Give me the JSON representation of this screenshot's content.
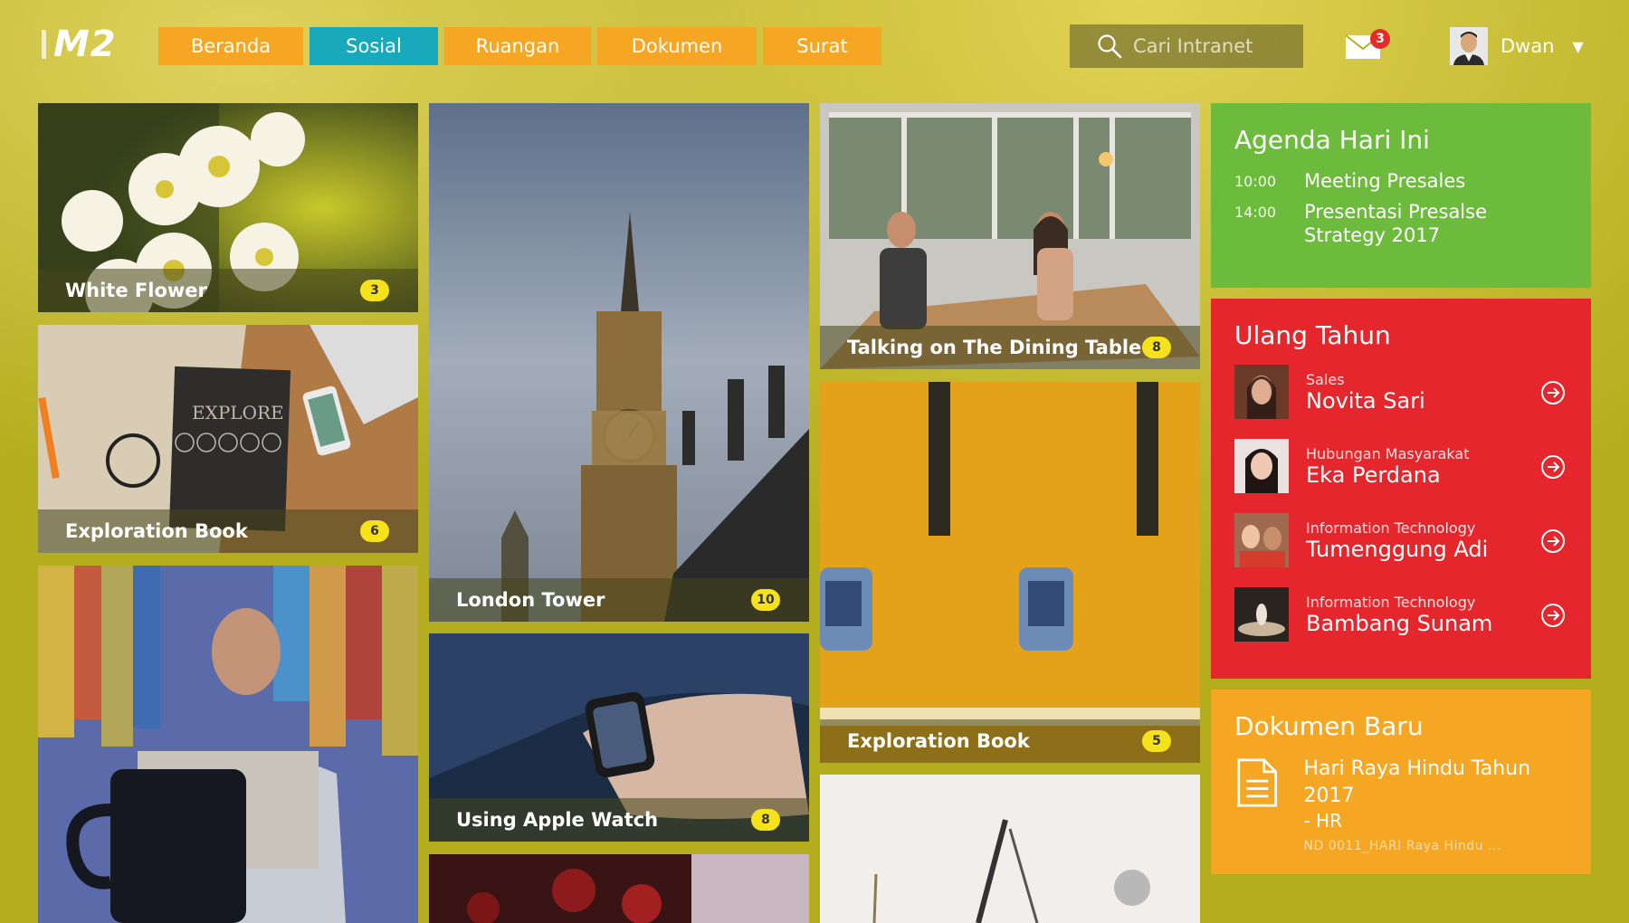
{
  "app": {
    "logo": "M2"
  },
  "nav": {
    "items": [
      {
        "label": "Beranda"
      },
      {
        "label": "Sosial"
      },
      {
        "label": "Ruangan"
      },
      {
        "label": "Dokumen"
      },
      {
        "label": "Surat"
      }
    ],
    "active": "Sosial"
  },
  "search": {
    "placeholder": "Cari Intranet"
  },
  "mail": {
    "unread": "3"
  },
  "user": {
    "name": "Dwan"
  },
  "tiles": [
    {
      "title": "White Flower",
      "count": "3"
    },
    {
      "title": "Exploration Book",
      "count": "6"
    },
    {
      "title": "London Tower",
      "count": "10"
    },
    {
      "title": "Using Apple Watch",
      "count": "8"
    },
    {
      "title": "Talking on The Dining Table",
      "count": "8"
    },
    {
      "title": "Exploration Book",
      "count": "5"
    }
  ],
  "agenda": {
    "title": "Agenda Hari Ini",
    "items": [
      {
        "time": "10:00",
        "title": "Meeting Presales"
      },
      {
        "time": "14:00",
        "title": "Presentasi Presalse Strategy 2017"
      }
    ]
  },
  "birthday": {
    "title": "Ulang Tahun",
    "people": [
      {
        "dept": "Sales",
        "name": "Novita Sari"
      },
      {
        "dept": "Hubungan Masyarakat",
        "name": "Eka Perdana"
      },
      {
        "dept": "Information Technology",
        "name": "Tumenggung Adi"
      },
      {
        "dept": "Information Technology",
        "name": "Bambang Sunam"
      }
    ]
  },
  "documents": {
    "title": "Dokumen Baru",
    "items": [
      {
        "title": "Hari Raya Hindu Tahun 2017",
        "tag": "- HR",
        "file": "ND 0011_HARI Raya Hindu ..."
      }
    ]
  },
  "colors": {
    "background": "#b4ae1f",
    "nav": "#f5a623",
    "nav_active": "#18a9bd",
    "agenda": "#6cbb3c",
    "birthday": "#e5272d",
    "documents": "#f5a623",
    "badge": "#f6e21a"
  }
}
